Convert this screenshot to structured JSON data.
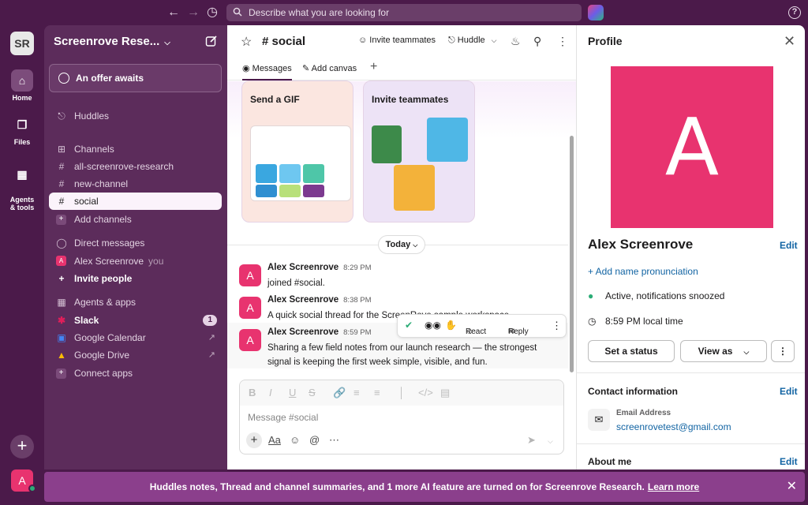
{
  "topbar": {
    "search_placeholder": "Describe what you are looking for",
    "help_label": "?"
  },
  "rail": {
    "workspace_initials": "SR",
    "items": [
      {
        "label": "Home"
      },
      {
        "label": "Files"
      },
      {
        "label": "Agents\n& tools"
      }
    ],
    "avatar_initial": "A"
  },
  "sidebar": {
    "workspace_name": "Screenrove Rese...",
    "offer": "An offer awaits",
    "huddles": "Huddles",
    "channels_header": "Channels",
    "channels": [
      "all-screenrove-research",
      "new-channel",
      "social"
    ],
    "add_channels": "Add channels",
    "dm_header": "Direct messages",
    "dm_user": "Alex Screenrove",
    "dm_you": "you",
    "invite_people": "Invite people",
    "apps_header": "Agents & apps",
    "apps": [
      {
        "name": "Slack",
        "badge": "1"
      },
      {
        "name": "Google Calendar"
      },
      {
        "name": "Google Drive"
      }
    ],
    "connect_apps": "Connect apps"
  },
  "channel": {
    "title": "# social",
    "invite_teammates": "Invite teammates",
    "huddle": "Huddle",
    "tabs": [
      "Messages",
      "Add canvas"
    ],
    "cards": [
      {
        "label": "Send a GIF"
      },
      {
        "label": "Invite teammates"
      }
    ],
    "day_divider": "Today",
    "messages": [
      {
        "author": "Alex Screenrove",
        "time": "8:29 PM",
        "text": "joined #social."
      },
      {
        "author": "Alex Screenrove",
        "time": "8:38 PM",
        "text": "A quick social thread for the ScreenRove sample workspace."
      },
      {
        "author": "Alex Screenrove",
        "time": "8:59 PM",
        "text": "Sharing a few field notes from our launch research — the strongest signal is keeping the first week simple, visible, and fun."
      }
    ],
    "hover_actions": {
      "react": "React",
      "reply": "Reply"
    },
    "composer_placeholder": "Message #social",
    "avatar_initial": "A"
  },
  "profile": {
    "title": "Profile",
    "avatar_initial": "A",
    "name": "Alex Screenrove",
    "edit": "Edit",
    "add_pronunciation": "+ Add name pronunciation",
    "status": "Active, notifications snoozed",
    "local_time": "8:59 PM local time",
    "set_status": "Set a status",
    "view_as": "View as",
    "contact_header": "Contact information",
    "email_label": "Email Address",
    "email": "screenrovetest@gmail.com",
    "about_header": "About me"
  },
  "banner": {
    "text": "Huddles notes, Thread and channel summaries, and 1 more AI feature are turned on for Screenrove Research.",
    "link": "Learn more"
  },
  "colors": {
    "aubergine": "#4b1a4a",
    "sidebar": "#5c2c5b",
    "avatar_pink": "#e8336f",
    "link_blue": "#1264a3",
    "banner": "#8b3f8c",
    "presence_green": "#2bac76"
  }
}
